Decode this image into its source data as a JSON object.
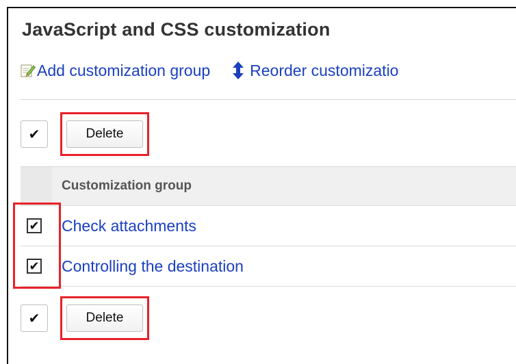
{
  "page": {
    "title": "JavaScript and CSS customization"
  },
  "actions": {
    "add_label": "Add customization group",
    "reorder_label": "Reorder customizatio"
  },
  "toolbar_top": {
    "toggle_glyph": "✔",
    "delete_label": "Delete"
  },
  "table": {
    "header": "Customization group",
    "rows": [
      {
        "label": "Check attachments",
        "checked": true
      },
      {
        "label": "Controlling the destination",
        "checked": true
      }
    ]
  },
  "toolbar_bottom": {
    "toggle_glyph": "✔",
    "delete_label": "Delete"
  },
  "checkmark_glyph": "✔",
  "colors": {
    "link": "#1a3fbf",
    "highlight": "#e8202a",
    "header_bg": "#f0f0f0"
  },
  "icons": {
    "add": "edit-pencil-icon",
    "reorder": "up-down-arrow-icon"
  }
}
